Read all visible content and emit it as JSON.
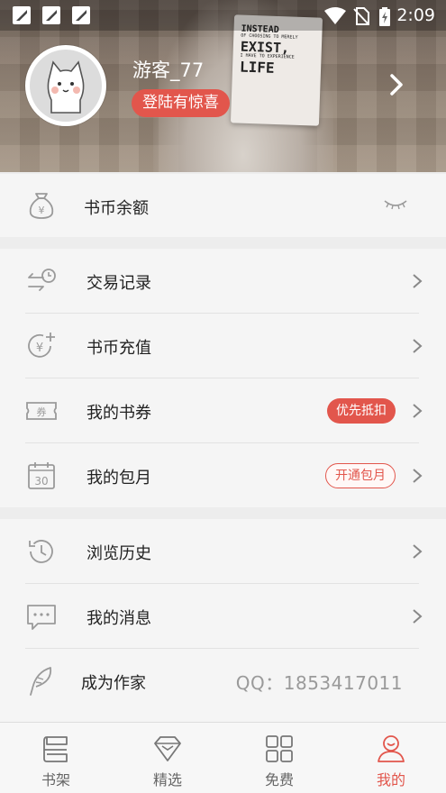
{
  "status_bar": {
    "time": "2:09",
    "notification_icons": [
      "app-notification-icon",
      "app-notification-icon",
      "app-notification-icon"
    ]
  },
  "profile": {
    "username": "游客_77",
    "login_badge": "登陆有惊喜",
    "book_cover_lines": [
      "INSTEAD",
      "OF CHOOSING TO MERELY",
      "EXIST,",
      "I HAVE TO EXPERIENCE",
      "LIFE"
    ]
  },
  "balance": {
    "label": "书币余额",
    "icon": "money-bag-icon"
  },
  "menu_group_1": [
    {
      "label": "交易记录",
      "icon": "transaction-history-icon"
    },
    {
      "label": "书币充值",
      "icon": "coin-recharge-icon"
    },
    {
      "label": "我的书券",
      "icon": "voucher-icon",
      "badge": "优先抵扣"
    },
    {
      "label": "我的包月",
      "icon": "calendar-icon",
      "badge": "开通包月"
    }
  ],
  "menu_group_2": [
    {
      "label": "浏览历史",
      "icon": "history-icon"
    },
    {
      "label": "我的消息",
      "icon": "message-icon"
    },
    {
      "label": "成为作家",
      "icon": "feather-icon",
      "info": "QQ：1853417011"
    }
  ],
  "bottom_nav": [
    {
      "label": "书架",
      "icon": "bookshelf-icon",
      "active": false
    },
    {
      "label": "精选",
      "icon": "diamond-icon",
      "active": false
    },
    {
      "label": "免费",
      "icon": "grid-icon",
      "active": false
    },
    {
      "label": "我的",
      "icon": "user-icon",
      "active": true
    }
  ],
  "colors": {
    "accent": "#e2564c",
    "background": "#ededed",
    "row_background": "#f5f5f5",
    "icon_gray": "#9a9a9a"
  }
}
